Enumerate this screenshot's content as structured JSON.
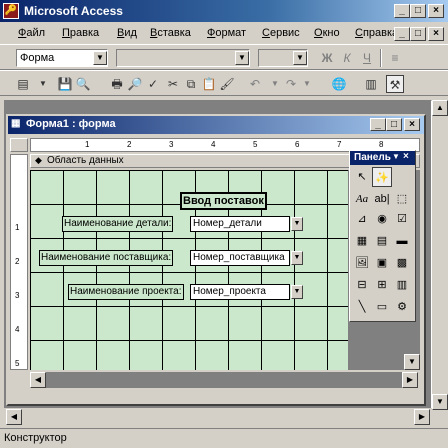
{
  "app": {
    "title": "Microsoft Access"
  },
  "menu": [
    "Файл",
    "Правка",
    "Вид",
    "Вставка",
    "Формат",
    "Сервис",
    "Окно",
    "Справка"
  ],
  "format_toolbar": {
    "object_combo": "Форма",
    "bold": "Ж",
    "italic": "К",
    "underline": "Ч"
  },
  "form_window": {
    "title": "Форма1 : форма",
    "ruler_numbers": [
      "1",
      "2",
      "3",
      "4",
      "5",
      "6",
      "7",
      "8"
    ],
    "section_label": "Область данных",
    "row_numbers": [
      "1",
      "2",
      "3",
      "4",
      "5"
    ],
    "controls": {
      "heading": "Ввод поставок",
      "label_detail": "Наименование детали:",
      "field_detail": "Номер_детали",
      "label_supplier": "Наименование поставщика:",
      "field_supplier": "Номер_поставщика",
      "label_project": "Наименование проекта:",
      "field_project": "Номер_проекта"
    }
  },
  "toolbox": {
    "title": "Панель"
  },
  "status": {
    "text": "Конструктор"
  }
}
